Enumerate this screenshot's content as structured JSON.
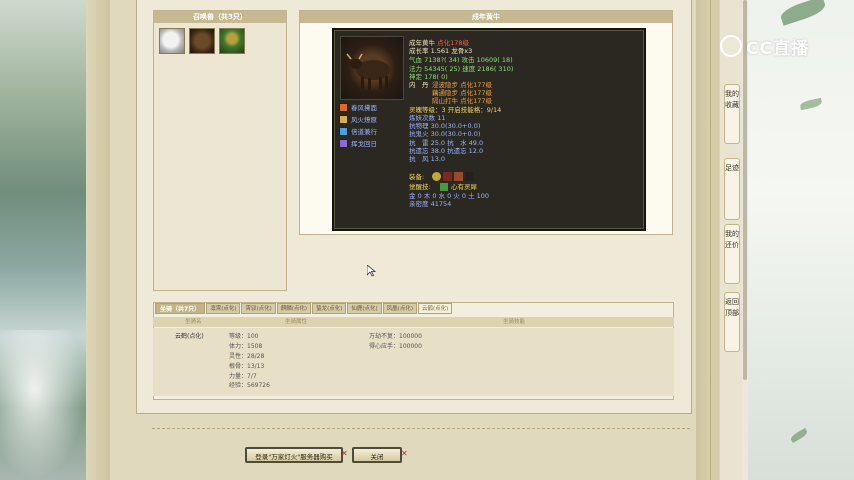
{
  "summon": {
    "title": "召唤兽（共3只）"
  },
  "detail": {
    "title": "成年黄牛",
    "name": "成年黄牛",
    "tag": "点化178级",
    "growth": "成长率 1.561  龙骨x3",
    "hp": "气血 7138?( 34)  攻击 10609( 18)",
    "mp": "法力 54345( 25)  速度 2186( 310)",
    "spirit": "神定 178( 0)",
    "dan_label": "内　丹",
    "dan": [
      "浸波隐步 点化177级",
      "藕通隐步 点化177级",
      "隔山打牛 点化177级"
    ],
    "skills": [
      "春风拂面",
      "风火燎原",
      "倍道兼行",
      "挥戈回日"
    ],
    "level_line": "灵魄等级：3  开启技能格：9/14",
    "refine": "炼妖次数 11",
    "resist": [
      "抗物理 30.0(30.0+0.0)",
      "抗鬼火 30.0(30.0+0.0)",
      "抗　雷 25.0  抗　水 49.0",
      "抗遗忘 38.0  抗遗忘 12.0",
      "抗　风 13.0"
    ],
    "equip_label": "装备:",
    "awake_label": "觉醒技:",
    "awake": "心有灵犀",
    "elements": "金 0  木 0  水 0  火 0  土 100",
    "intimacy": "亲密度 41754"
  },
  "mount": {
    "tabs": [
      "坐骑（共7只）",
      "凛霄(点化)",
      "霄驭(点化)",
      "麒麟(点化)",
      "蛰龙(点化)",
      "仙鹿(点化)",
      "凤凰(点化)",
      "云鹤(点化)"
    ],
    "headers": [
      "坐骑名",
      "坐骑属性",
      "坐骑技能"
    ],
    "row": {
      "name": "云鹤(点化)",
      "attrs": [
        "等级：100",
        "体力：1508",
        "灵性：28/28",
        "根骨：13/13",
        "力量：7/7",
        "经验：569726"
      ],
      "skills": [
        [
          "万劫不复：",
          "100000"
        ],
        [
          "得心应手：",
          "100000"
        ]
      ]
    }
  },
  "buttons": {
    "login": "登录\"万家灯火\"服务器购买",
    "close": "关闭"
  },
  "right_nav": [
    "我的收藏",
    "足迹",
    "我的还价",
    "返回顶部"
  ],
  "cc_logo": "CC直播"
}
